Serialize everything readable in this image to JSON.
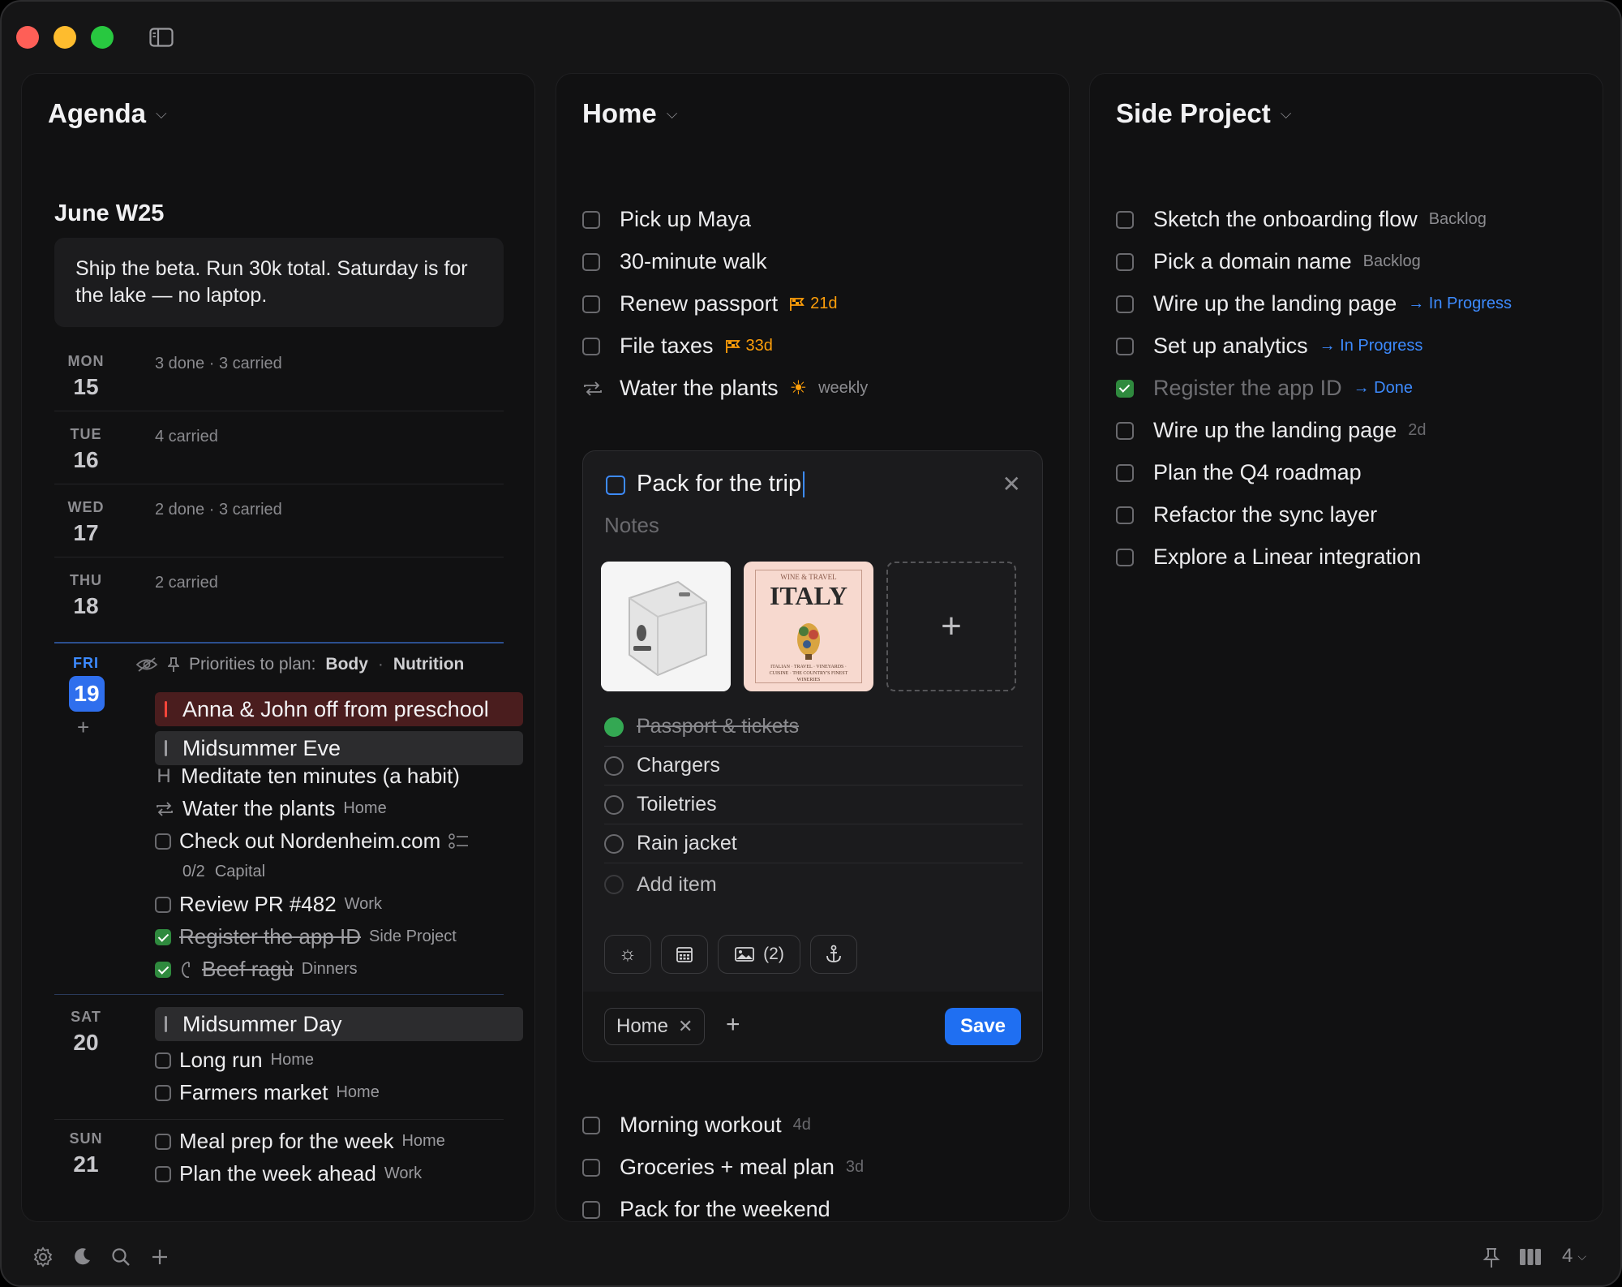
{
  "columns": {
    "agenda": {
      "title": "Agenda"
    },
    "home": {
      "title": "Home"
    },
    "side": {
      "title": "Side Project"
    }
  },
  "agenda": {
    "week_title": "June W25",
    "goal": "Ship the beta. Run 30k total. Saturday is for the lake — no laptop.",
    "days": [
      {
        "label": "MON",
        "num": "15",
        "summary": "3 done · 3 carried"
      },
      {
        "label": "TUE",
        "num": "16",
        "summary": "4 carried"
      },
      {
        "label": "WED",
        "num": "17",
        "summary": "2 done · 3 carried"
      },
      {
        "label": "THU",
        "num": "18",
        "summary": "2 carried"
      }
    ],
    "friday": {
      "label": "FRI",
      "num": "19",
      "add": "+",
      "priorities_label": "Priorities to plan:",
      "priorities": [
        "Body",
        "Nutrition"
      ],
      "events": [
        "Anna & John off from preschool",
        "Midsummer Eve"
      ],
      "habit_marker": "H",
      "habit": "Meditate ten minutes (a habit)",
      "items": [
        {
          "text": "Water the plants",
          "tag": "Home"
        },
        {
          "text": "Check out Nordenheim.com",
          "sub": "0/2",
          "tag": "Capital"
        },
        {
          "text": "Review PR #482",
          "tag": "Work"
        },
        {
          "text": "Register the app ID",
          "tag": "Side Project"
        },
        {
          "text": "Beef ragù",
          "tag": "Dinners"
        }
      ]
    },
    "saturday": {
      "label": "SAT",
      "num": "20",
      "event": "Midsummer Day",
      "items": [
        {
          "text": "Long run",
          "tag": "Home"
        },
        {
          "text": "Farmers market",
          "tag": "Home"
        }
      ]
    },
    "sunday": {
      "label": "SUN",
      "num": "21",
      "items": [
        {
          "text": "Meal prep for the week",
          "tag": "Home"
        },
        {
          "text": "Plan the week ahead",
          "tag": "Work"
        }
      ]
    }
  },
  "home": {
    "tasks": [
      {
        "text": "Pick up Maya"
      },
      {
        "text": "30-minute walk"
      },
      {
        "text": "Renew passport",
        "flag": "21d"
      },
      {
        "text": "File taxes",
        "flag": "33d"
      },
      {
        "text": "Water the plants",
        "tag": "weekly"
      }
    ],
    "editor": {
      "title": "Pack for the trip",
      "notes_placeholder": "Notes",
      "book_top": "WINE & TRAVEL",
      "book_title": "ITALY",
      "book_caption": "ITALIAN · TRAVEL · VINEYARDS · CUISINE · THE COUNTRY'S FINEST WINERIES",
      "add_image": "+",
      "subtasks": [
        {
          "text": "Passport & tickets",
          "done": true
        },
        {
          "text": "Chargers"
        },
        {
          "text": "Toiletries"
        },
        {
          "text": "Rain jacket"
        },
        {
          "text": "Add item"
        }
      ],
      "images_count": "(2)",
      "chip": "Home",
      "chip_close": "✕",
      "add_tag": "+",
      "save_label": "Save"
    },
    "tasks_after": [
      {
        "text": "Morning workout",
        "tag": "4d"
      },
      {
        "text": "Groceries + meal plan",
        "tag": "3d"
      },
      {
        "text": "Pack for the weekend"
      }
    ]
  },
  "side": {
    "tasks": [
      {
        "text": "Sketch the onboarding flow",
        "tag": "Backlog"
      },
      {
        "text": "Pick a domain name",
        "tag": "Backlog"
      },
      {
        "text": "Wire up the landing page",
        "status": "→ In Progress"
      },
      {
        "text": "Set up analytics",
        "status": "→ In Progress"
      },
      {
        "text": "Register the app ID",
        "status": "→ Done"
      },
      {
        "text": "Wire up the landing page",
        "tag": "2d"
      },
      {
        "text": "Plan the Q4 roadmap"
      },
      {
        "text": "Refactor the sync layer"
      },
      {
        "text": "Explore a Linear integration"
      }
    ]
  },
  "bottom": {
    "columns_count": "4"
  },
  "colors": {
    "accent": "#1f6ff2",
    "done_green": "#2f8a3e",
    "flag_orange": "#ff9f0a",
    "event_red": "#ff453a"
  },
  "icons": [
    "sidebar-toggle-icon",
    "eye-slash-icon",
    "pin-icon",
    "repeat-icon",
    "subtasks-icon",
    "sun-icon",
    "calendar-icon",
    "image-icon",
    "anchor-icon",
    "gear-icon",
    "moon-icon",
    "search-icon",
    "plus-icon",
    "columns-icon",
    "flag-icon"
  ]
}
